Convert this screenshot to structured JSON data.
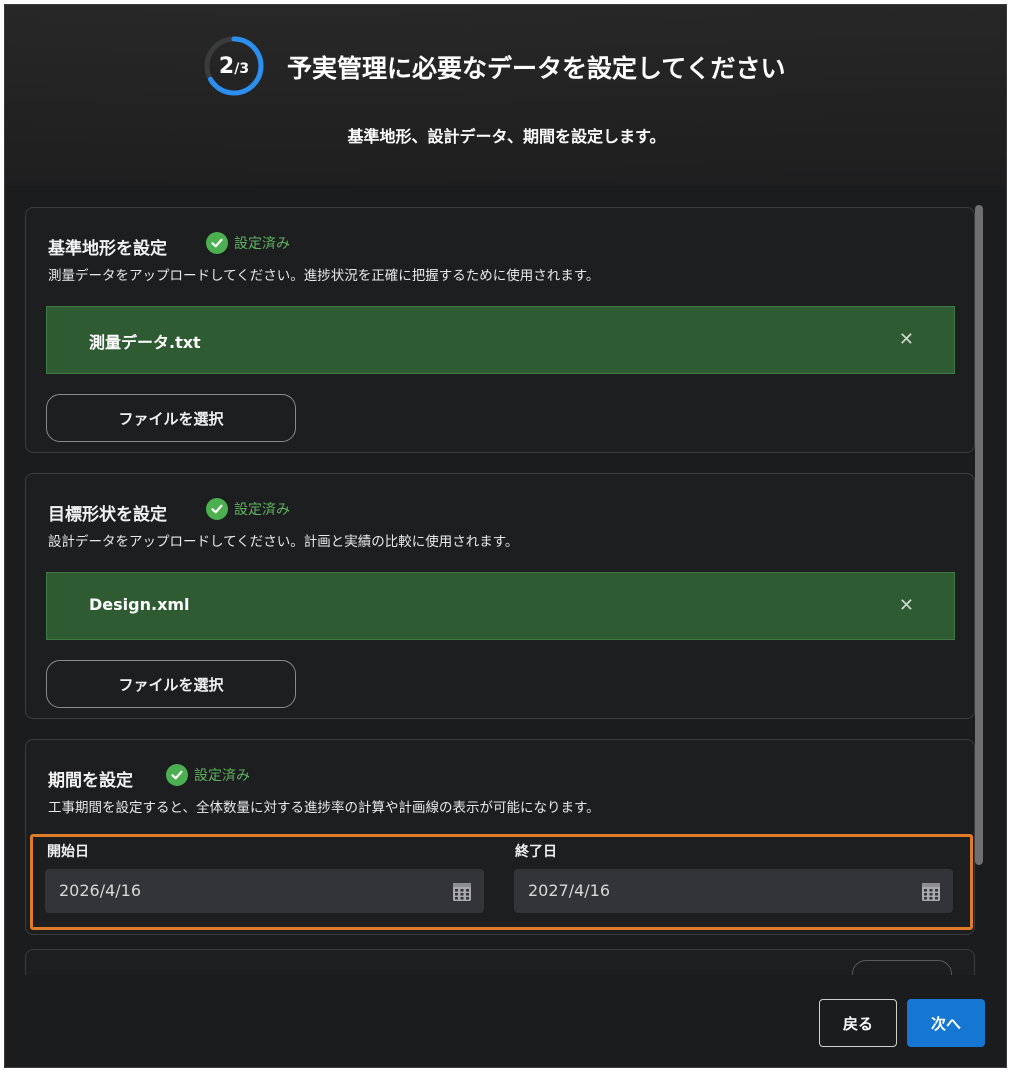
{
  "header": {
    "step_current": "2",
    "step_total": "/3",
    "step_progress": 0.667,
    "title": "予実管理に必要なデータを設定してください",
    "subtitle": "基準地形、設計データ、期間を設定します。"
  },
  "sections": {
    "terrain": {
      "title": "基準地形を設定",
      "status": "設定済み",
      "description": "測量データをアップロードしてください。進捗状況を正確に把握するために使用されます。",
      "file_name": "測量データ.txt",
      "button_label": "ファイルを選択"
    },
    "design": {
      "title": "目標形状を設定",
      "status": "設定済み",
      "description": "設計データをアップロードしてください。計画と実績の比較に使用されます。",
      "file_name": "Design.xml",
      "button_label": "ファイルを選択"
    },
    "period": {
      "title": "期間を設定",
      "status": "設定済み",
      "description": "工事期間を設定すると、全体数量に対する進捗率の計算や計画線の表示が可能になります。",
      "start_label": "開始日",
      "start_value": "2026/4/16",
      "end_label": "終了日",
      "end_value": "2027/4/16"
    }
  },
  "footer": {
    "back_label": "戻る",
    "next_label": "次へ"
  },
  "colors": {
    "accent": "#1677d2",
    "success": "#4caf50",
    "file_bar": "#2f5b33",
    "highlight": "#e07b2a"
  },
  "icons": {
    "step": "progress-ring-icon",
    "status": "check-circle-icon",
    "remove": "close-icon",
    "date": "calendar-icon"
  }
}
